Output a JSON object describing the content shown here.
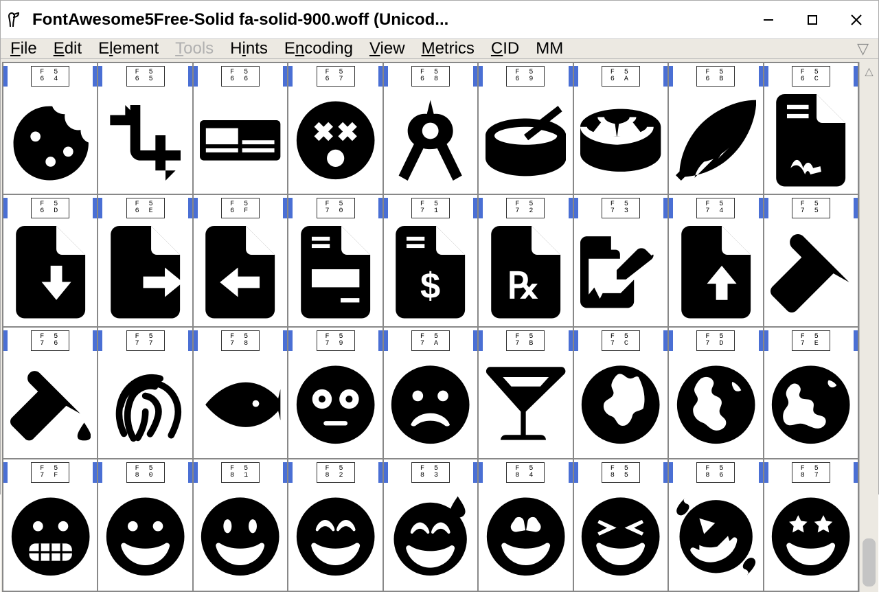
{
  "window": {
    "title": "FontAwesome5Free-Solid  fa-solid-900.woff (Unicod..."
  },
  "menu": {
    "file": "File",
    "edit": "Edit",
    "element": "Element",
    "tools": "Tools",
    "hints": "Hints",
    "encoding": "Encoding",
    "view": "View",
    "metrics": "Metrics",
    "cid": "CID",
    "mm": "MM"
  },
  "glyph_grid": {
    "rows": [
      [
        {
          "code_top": "F 5",
          "code_bot": "6 4",
          "name": "cookie-bite"
        },
        {
          "code_top": "F 5",
          "code_bot": "6 5",
          "name": "crop-alt"
        },
        {
          "code_top": "F 5",
          "code_bot": "6 6",
          "name": "digital-tachograph"
        },
        {
          "code_top": "F 5",
          "code_bot": "6 7",
          "name": "dizzy"
        },
        {
          "code_top": "F 5",
          "code_bot": "6 8",
          "name": "drafting-compass"
        },
        {
          "code_top": "F 5",
          "code_bot": "6 9",
          "name": "drum"
        },
        {
          "code_top": "F 5",
          "code_bot": "6 A",
          "name": "drum-steelpan"
        },
        {
          "code_top": "F 5",
          "code_bot": "6 B",
          "name": "feather-alt"
        },
        {
          "code_top": "F 5",
          "code_bot": "6 C",
          "name": "file-contract"
        }
      ],
      [
        {
          "code_top": "F 5",
          "code_bot": "6 D",
          "name": "file-download"
        },
        {
          "code_top": "F 5",
          "code_bot": "6 E",
          "name": "file-export"
        },
        {
          "code_top": "F 5",
          "code_bot": "6 F",
          "name": "file-import"
        },
        {
          "code_top": "F 5",
          "code_bot": "7 0",
          "name": "file-invoice"
        },
        {
          "code_top": "F 5",
          "code_bot": "7 1",
          "name": "file-invoice-dollar"
        },
        {
          "code_top": "F 5",
          "code_bot": "7 2",
          "name": "file-prescription"
        },
        {
          "code_top": "F 5",
          "code_bot": "7 3",
          "name": "file-signature"
        },
        {
          "code_top": "F 5",
          "code_bot": "7 4",
          "name": "file-upload"
        },
        {
          "code_top": "F 5",
          "code_bot": "7 5",
          "name": "fill"
        }
      ],
      [
        {
          "code_top": "F 5",
          "code_bot": "7 6",
          "name": "fill-drip"
        },
        {
          "code_top": "F 5",
          "code_bot": "7 7",
          "name": "fingerprint"
        },
        {
          "code_top": "F 5",
          "code_bot": "7 8",
          "name": "fish"
        },
        {
          "code_top": "F 5",
          "code_bot": "7 9",
          "name": "flushed"
        },
        {
          "code_top": "F 5",
          "code_bot": "7 A",
          "name": "frown-open"
        },
        {
          "code_top": "F 5",
          "code_bot": "7 B",
          "name": "glass-martini-alt"
        },
        {
          "code_top": "F 5",
          "code_bot": "7 C",
          "name": "globe-africa"
        },
        {
          "code_top": "F 5",
          "code_bot": "7 D",
          "name": "globe-americas"
        },
        {
          "code_top": "F 5",
          "code_bot": "7 E",
          "name": "globe-asia"
        }
      ],
      [
        {
          "code_top": "F 5",
          "code_bot": "7 F",
          "name": "grimace"
        },
        {
          "code_top": "F 5",
          "code_bot": "8 0",
          "name": "grin"
        },
        {
          "code_top": "F 5",
          "code_bot": "8 1",
          "name": "grin-alt"
        },
        {
          "code_top": "F 5",
          "code_bot": "8 2",
          "name": "grin-beam"
        },
        {
          "code_top": "F 5",
          "code_bot": "8 3",
          "name": "grin-beam-sweat"
        },
        {
          "code_top": "F 5",
          "code_bot": "8 4",
          "name": "grin-hearts"
        },
        {
          "code_top": "F 5",
          "code_bot": "8 5",
          "name": "grin-squint"
        },
        {
          "code_top": "F 5",
          "code_bot": "8 6",
          "name": "grin-squint-tears"
        },
        {
          "code_top": "F 5",
          "code_bot": "8 7",
          "name": "grin-stars"
        }
      ]
    ]
  }
}
